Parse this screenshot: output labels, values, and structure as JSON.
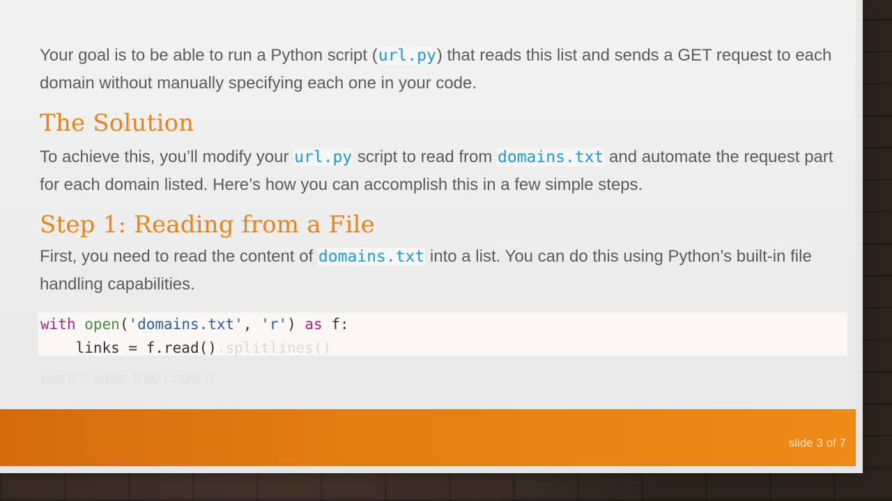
{
  "paragraph1": {
    "before": "Your goal is to be able to run a Python script (",
    "code": "url.py",
    "after": ") that reads this list and sends a GET request to each domain without manually specifying each one in your code."
  },
  "heading1": "The Solution",
  "paragraph2": {
    "before": "To achieve this, you’ll modify your ",
    "code1": "url.py",
    "middle": " script to read from ",
    "code2": "domains.txt",
    "after": " and automate the request part for each domain listed. Here’s how you can accomplish this in a few simple steps."
  },
  "heading2": "Step 1: Reading from a File",
  "paragraph3": {
    "before": "First, you need to read the content of ",
    "code": "domains.txt",
    "after": " into a list. You can do this using Python’s built-in file handling capabilities."
  },
  "code_block": {
    "line1": {
      "kw_with": "with",
      "builtin_open": "open",
      "paren_open": "(",
      "str1": "'domains.txt'",
      "comma": ", ",
      "str2": "'r'",
      "paren_close": ") ",
      "kw_as": "as",
      "rest": " f:"
    },
    "line2": {
      "indent": "    ",
      "main": "links = f.read()",
      "faded": ".splitlines()"
    }
  },
  "ghost_text": "Here’s what this code d",
  "footer": {
    "slide_label": "slide 3 of 7"
  },
  "colors": {
    "accent": "#e8841a",
    "code_inline": "#1a9ad6",
    "footer": "#e47d12"
  }
}
